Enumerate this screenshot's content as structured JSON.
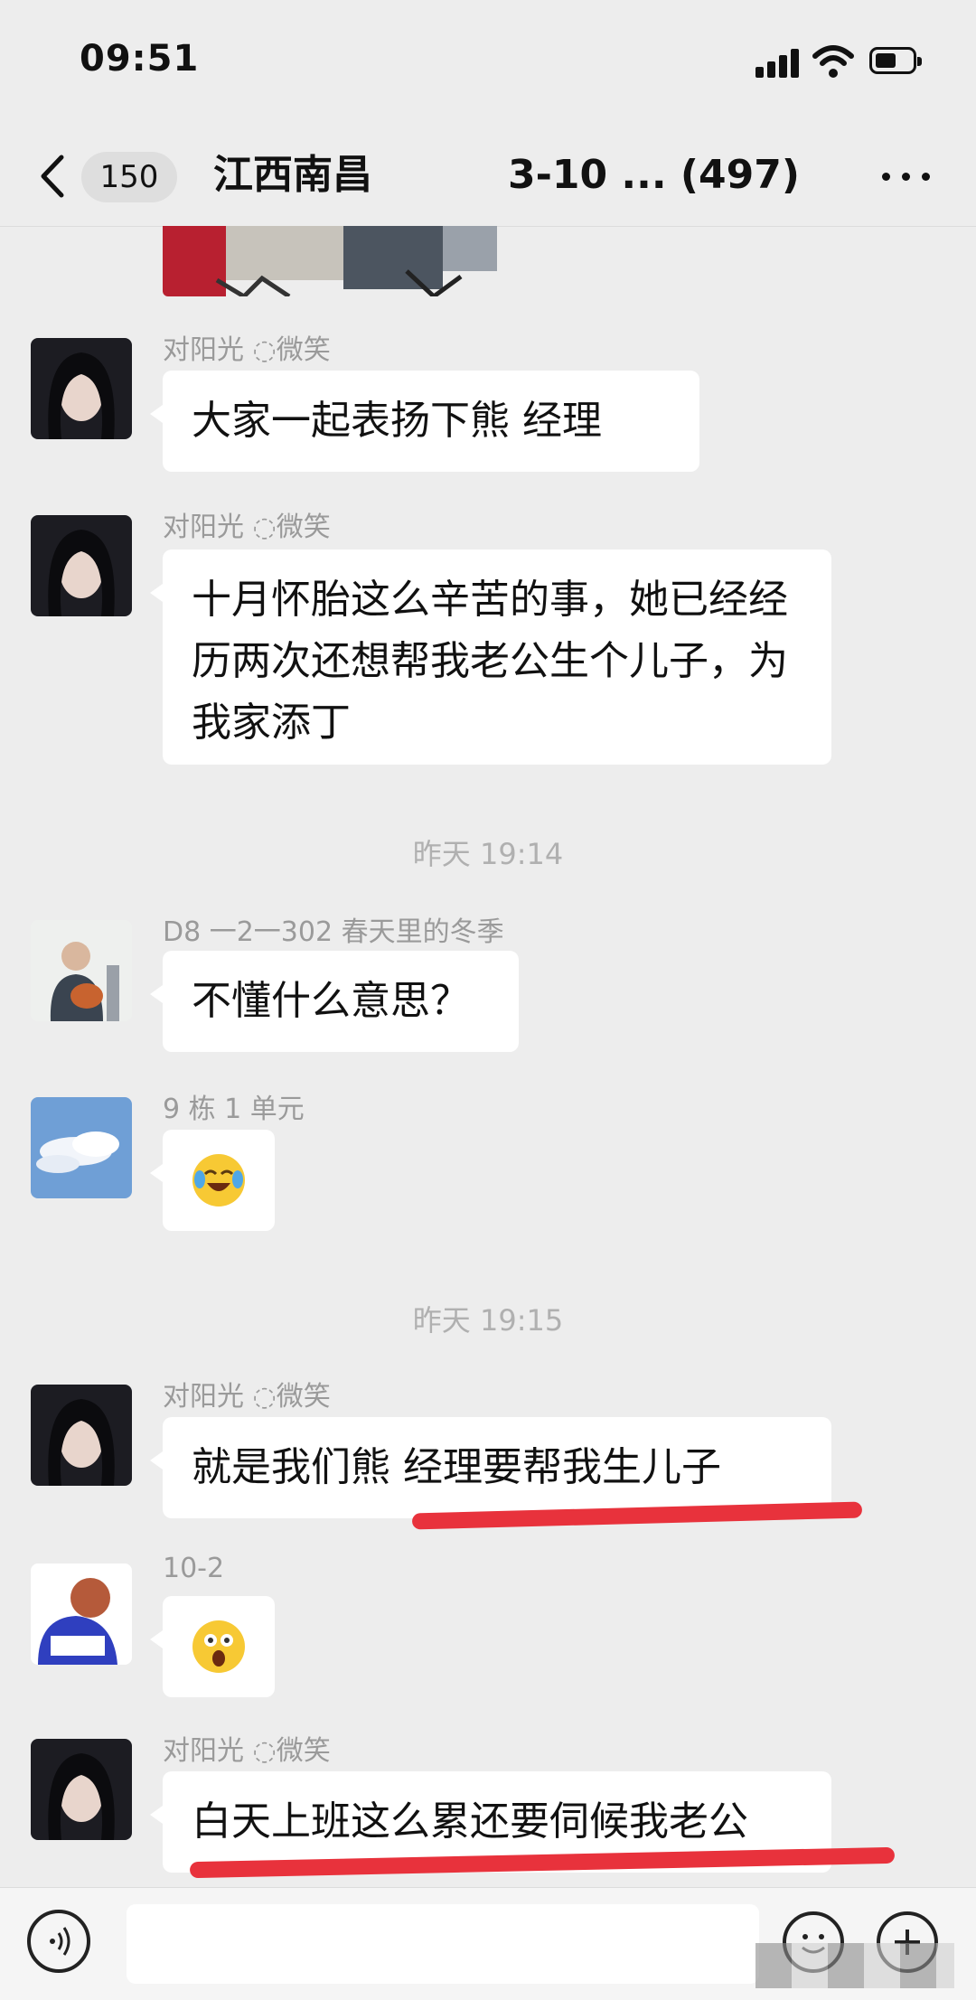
{
  "status_bar": {
    "time": "09:51"
  },
  "header": {
    "unread_count": "150",
    "title_left": "江西南昌",
    "title_right": "3-10 ... (497)"
  },
  "messages": [
    {
      "sender": "对阳光 ◌微笑",
      "text": "大家一起表扬下熊    经理"
    },
    {
      "sender": "对阳光 ◌微笑",
      "text": "十月怀胎这么辛苦的事，她已经经历两次还想帮我老公生个儿子，为我家添丁"
    },
    {
      "timestamp": "昨天 19:14"
    },
    {
      "sender": "D8 一2一302 春天里的冬季",
      "text": "不懂什么意思？"
    },
    {
      "sender": "9 栋 1 单元",
      "emoji": "crying-laughing-emoji"
    },
    {
      "timestamp": "昨天 19:15"
    },
    {
      "sender": "对阳光 ◌微笑",
      "text": "就是我们熊  经理要帮我生儿子"
    },
    {
      "sender": "10-2",
      "emoji": "shocked-emoji"
    },
    {
      "sender": "对阳光 ◌微笑",
      "text": "白天上班这么累还要伺候我老公"
    }
  ],
  "colors": {
    "background": "#ededed",
    "bubble": "#ffffff",
    "highlight_stroke": "#e8323c"
  }
}
